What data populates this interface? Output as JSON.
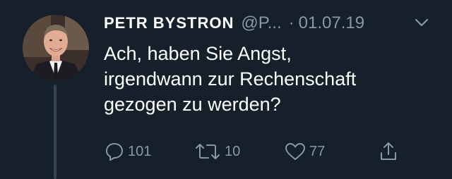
{
  "tweet": {
    "author": {
      "display_name": "PETR BYSTRON",
      "handle": "@P...",
      "avatar_icon": "profile-photo"
    },
    "separator": "·",
    "date": "01.07.19",
    "text_lines": [
      "Ach, haben Sie Angst,",
      "irgendwann zur Rechenschaft",
      "gezogen zu werden?"
    ],
    "actions": {
      "reply": {
        "icon": "speech-bubble-icon",
        "count": "101"
      },
      "retweet": {
        "icon": "retweet-arrows-icon",
        "count": "10"
      },
      "like": {
        "icon": "heart-icon",
        "count": "77"
      },
      "share": {
        "icon": "share-upload-icon",
        "count": ""
      }
    },
    "menu_icon": "chevron-down-icon"
  },
  "colors": {
    "background": "#15202b",
    "text_primary": "#ffffff",
    "text_secondary": "#8899a6",
    "thread_line": "#38444d"
  }
}
